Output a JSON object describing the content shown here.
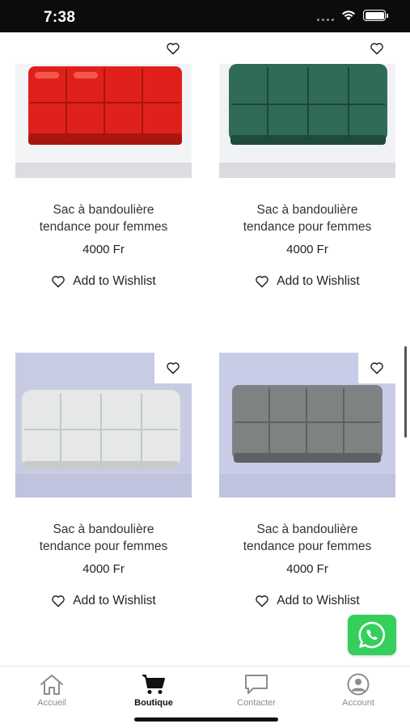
{
  "status_bar": {
    "time": "7:38"
  },
  "products": [
    {
      "name": "Sac à bandoulière tendance pour femmes",
      "price": "4000 Fr",
      "wishlist_label": "Add to Wishlist",
      "bag_color": "#e0211b",
      "bg_color": "#ffffff"
    },
    {
      "name": "Sac à bandoulière tendance pour femmes",
      "price": "4000 Fr",
      "wishlist_label": "Add to Wishlist",
      "bag_color": "#2f6b57",
      "bg_color": "#ffffff"
    },
    {
      "name": "Sac à bandoulière tendance pour femmes",
      "price": "4000 Fr",
      "wishlist_label": "Add to Wishlist",
      "bag_color": "#e6e8e8",
      "bg_color": "#c7cbe4"
    },
    {
      "name": "Sac à bandoulière tendance pour femmes",
      "price": "4000 Fr",
      "wishlist_label": "Add to Wishlist",
      "bag_color": "#7f8283",
      "bg_color": "#c9cce6"
    }
  ],
  "tabs": [
    {
      "label": "Accueil",
      "icon": "home-icon",
      "active": false
    },
    {
      "label": "Boutique",
      "icon": "cart-icon",
      "active": true
    },
    {
      "label": "Contacter",
      "icon": "chat-bubble-icon",
      "active": false
    },
    {
      "label": "Account",
      "icon": "account-icon",
      "active": false
    }
  ],
  "colors": {
    "whatsapp": "#35cf5b",
    "status_bar": "#0c0c0c"
  }
}
